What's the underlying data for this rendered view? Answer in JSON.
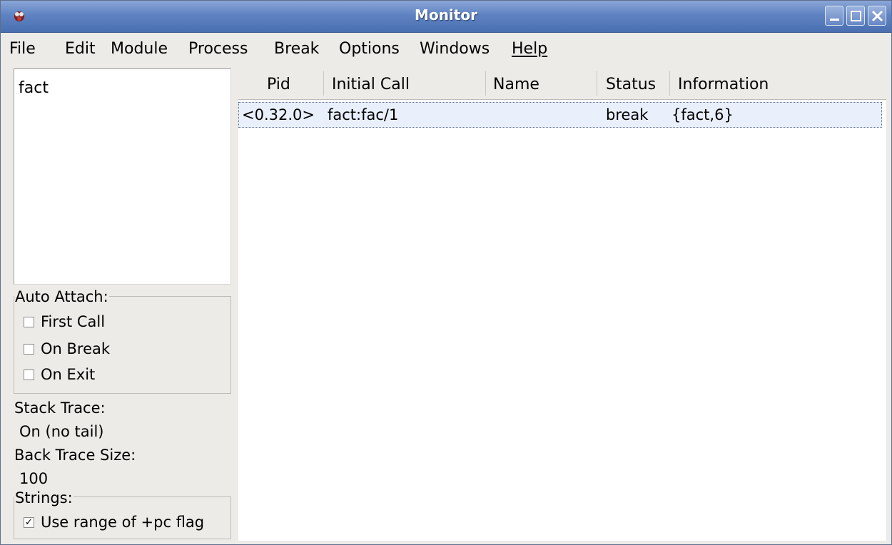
{
  "window": {
    "title": "Monitor"
  },
  "menu": [
    "File",
    "Edit",
    "Module",
    "Process",
    "Break",
    "Options",
    "Windows",
    "Help"
  ],
  "modules": [
    "fact"
  ],
  "auto_attach": {
    "title": "Auto Attach:",
    "options": [
      {
        "label": "First Call",
        "checked": false
      },
      {
        "label": "On Break",
        "checked": false
      },
      {
        "label": "On Exit",
        "checked": false
      }
    ]
  },
  "stack_trace": {
    "label": "Stack Trace:",
    "value": "On (no tail)"
  },
  "back_trace": {
    "label": "Back Trace Size:",
    "value": "100"
  },
  "strings": {
    "title": "Strings:",
    "option": {
      "label": "Use range of +pc flag",
      "checked": true,
      "mark": "✓"
    }
  },
  "table": {
    "columns": [
      "Pid",
      "Initial Call",
      "Name",
      "Status",
      "Information"
    ],
    "rows": [
      {
        "pid": "<0.32.0>",
        "initial_call": "fact:fac/1",
        "name": "",
        "status": "break",
        "information": "{fact,6}"
      }
    ]
  },
  "colors": {
    "title_bar": "#5f83c2",
    "selected_row": "#eaf0fb",
    "panel_bg": "#ecebe7"
  }
}
